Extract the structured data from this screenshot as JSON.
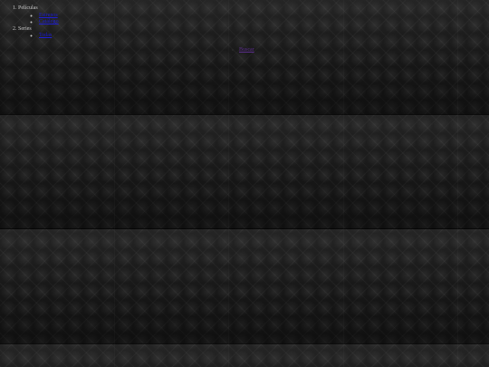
{
  "nav": {
    "items": [
      {
        "label": "Películas",
        "children": [
          {
            "label": "Estrenos"
          },
          {
            "label": "Catálogo"
          }
        ]
      },
      {
        "label": "Series",
        "children": [
          {
            "label": "Todas"
          }
        ]
      }
    ]
  },
  "floating_link": {
    "label": "Buscar"
  }
}
